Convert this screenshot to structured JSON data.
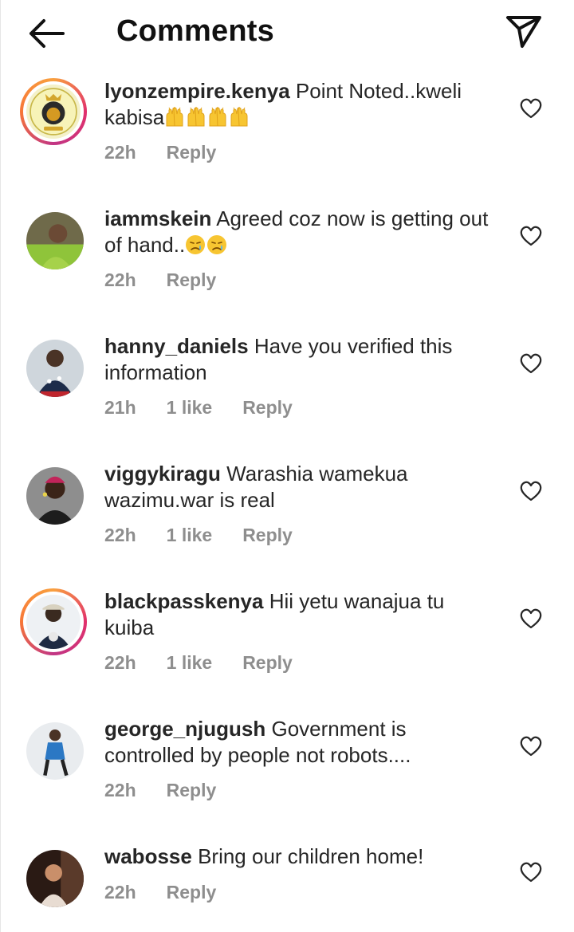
{
  "header": {
    "title": "Comments",
    "back_icon": "arrow-left-icon",
    "send_icon": "paper-plane-icon"
  },
  "comments": [
    {
      "username": "lyonzempire.kenya",
      "text": "Point Noted..kweli kabisa",
      "emoji": [
        "raising-hands",
        "raising-hands",
        "raising-hands",
        "raising-hands"
      ],
      "time": "22h",
      "likes": "",
      "reply": "Reply",
      "story_ring": true,
      "avatar": "lion-logo"
    },
    {
      "username": "iammskein",
      "text": "Agreed coz now is getting out of hand..",
      "emoji": [
        "crying-face",
        "crying-face"
      ],
      "time": "22h",
      "likes": "",
      "reply": "Reply",
      "story_ring": false,
      "avatar": "person-photo"
    },
    {
      "username": "hanny_daniels",
      "text": "Have you verified this information",
      "emoji": [],
      "time": "21h",
      "likes": "1 like",
      "reply": "Reply",
      "story_ring": false,
      "avatar": "person-photo"
    },
    {
      "username": "viggykiragu",
      "text": "Warashia wamekua wazimu.war is real",
      "emoji": [],
      "time": "22h",
      "likes": "1 like",
      "reply": "Reply",
      "story_ring": false,
      "avatar": "person-photo"
    },
    {
      "username": "blackpasskenya",
      "text": "Hii yetu wanajua tu kuiba",
      "emoji": [],
      "time": "22h",
      "likes": "1 like",
      "reply": "Reply",
      "story_ring": true,
      "avatar": "person-photo"
    },
    {
      "username": "george_njugush",
      "text": "Government is controlled by people not robots....",
      "emoji": [],
      "time": "22h",
      "likes": "",
      "reply": "Reply",
      "story_ring": false,
      "avatar": "person-photo"
    },
    {
      "username": "wabosse",
      "text": "Bring our children home!",
      "emoji": [],
      "time": "22h",
      "likes": "",
      "reply": "Reply",
      "story_ring": false,
      "avatar": "person-photo"
    }
  ],
  "colors": {
    "text": "#262626",
    "meta": "#8e8e8e",
    "ring_start": "#f9a03f",
    "ring_end": "#c13584"
  }
}
